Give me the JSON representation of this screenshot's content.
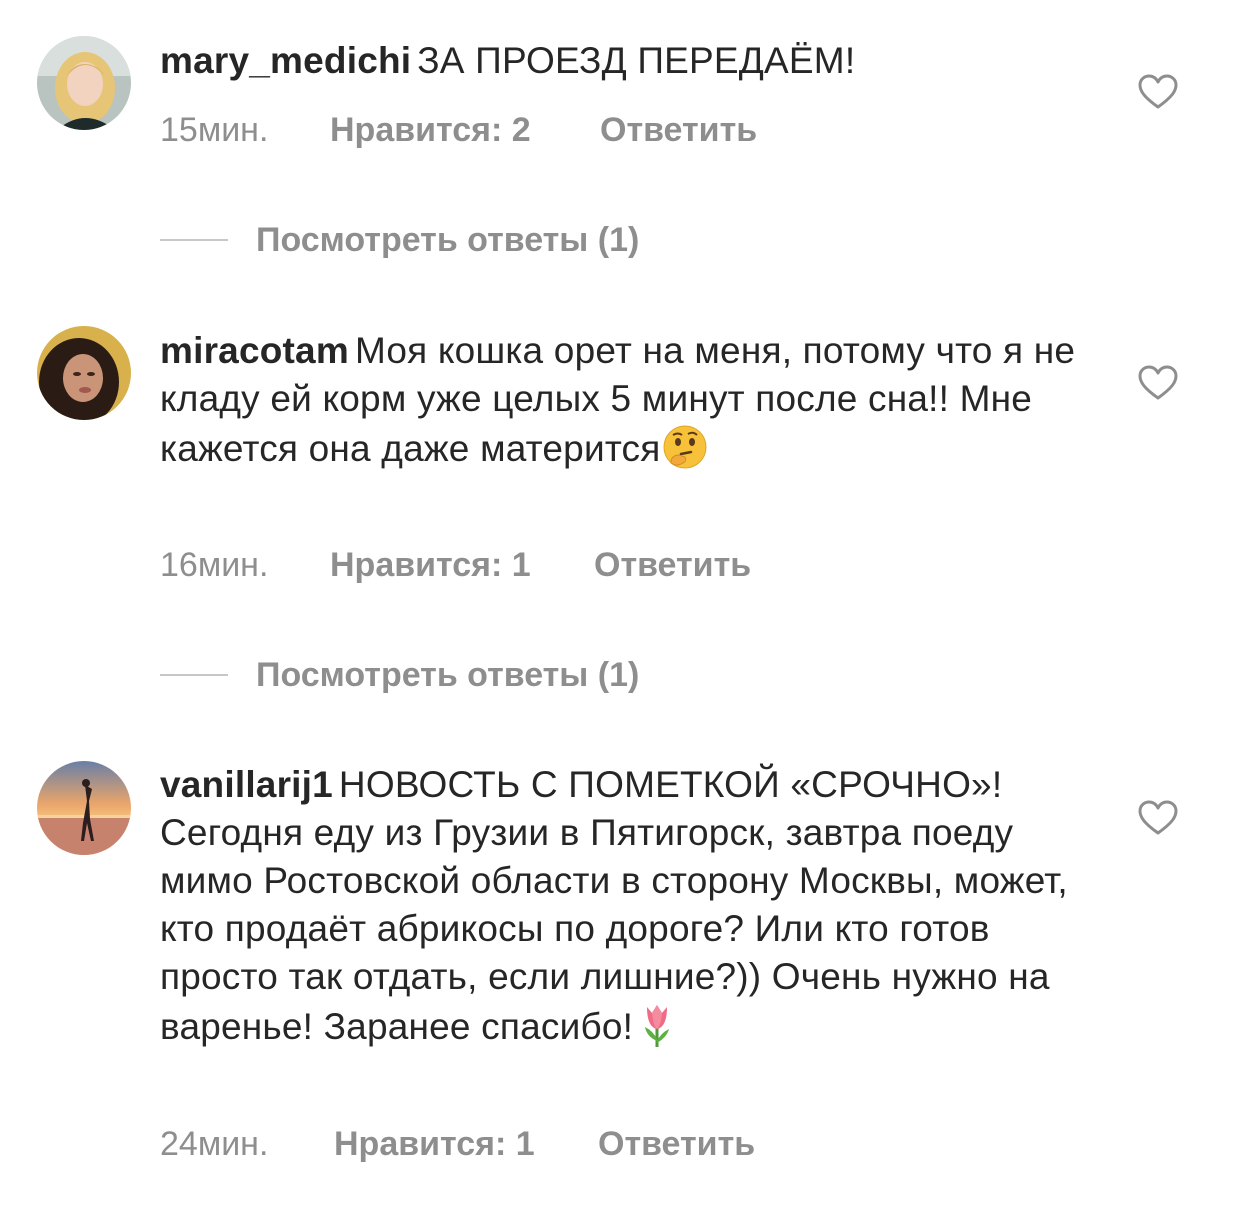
{
  "comments": [
    {
      "username": "mary_medichi",
      "text": "ЗА ПРОЕЗД ПЕРЕДАЁМ!",
      "time": "15мин.",
      "likes": "Нравится: 2",
      "reply": "Ответить",
      "view_replies": "Посмотреть ответы (1)",
      "avatar_icon": "avatar-blonde-woman"
    },
    {
      "username": "miracotam",
      "text": "Моя кошка орет на меня, потому что я не кладу ей корм уже целых 5 минут после сна!! Мне кажется она даже матерится",
      "emoji": "thinking-face-emoji",
      "time": "16мин.",
      "likes": "Нравится: 1",
      "reply": "Ответить",
      "view_replies": "Посмотреть ответы (1)",
      "avatar_icon": "avatar-dark-haired-woman"
    },
    {
      "username": "vanillarij1",
      "text": "НОВОСТЬ С ПОМЕТКОЙ «СРОЧНО»! Сегодня еду из Грузии в Пятигорск, завтра поеду мимо Ростовской области в сторону Москвы, может, кто продаёт абрикосы по дороге? Или кто готов просто так отдать, если лишние?)) Очень нужно на варенье! Заранее спасибо!",
      "emoji": "tulip-emoji",
      "time": "24мин.",
      "likes": "Нравится: 1",
      "reply": "Ответить",
      "avatar_icon": "avatar-beach-sunset"
    }
  ],
  "colors": {
    "text": "#262626",
    "secondary": "#8e8e8e",
    "divider": "#c7c7c7",
    "background": "#ffffff"
  }
}
